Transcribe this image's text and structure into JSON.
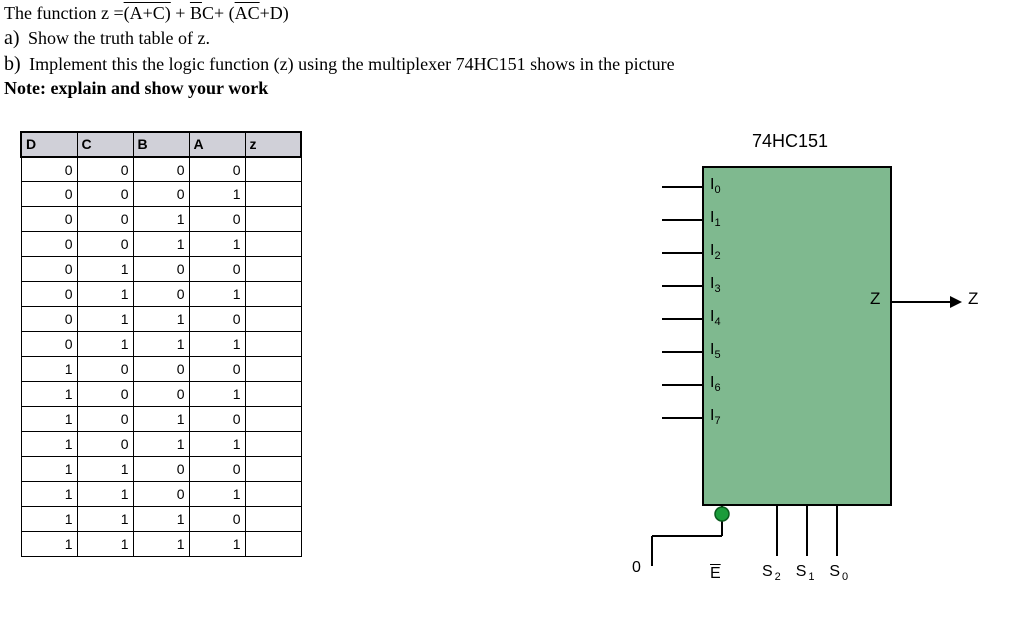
{
  "question": {
    "line1_prefix": "The function z =",
    "line1_term1": "(A+C)",
    "line1_plus1": " + ",
    "line1_Bbar": "B",
    "line1_C": "C+ (",
    "line1_ACbar": "AC",
    "line1_plusD": "+D)",
    "a_label": "a)",
    "a_text": "Show the truth table of z.",
    "b_label": "b)",
    "b_text": "Implement this the logic function (z) using the multiplexer 74HC151 shows in the picture",
    "note_label": "Note: ",
    "note_text": "explain and show your work"
  },
  "table": {
    "headers": [
      "D",
      "C",
      "B",
      "A",
      "z"
    ],
    "rows": [
      [
        "0",
        "0",
        "0",
        "0",
        ""
      ],
      [
        "0",
        "0",
        "0",
        "1",
        ""
      ],
      [
        "0",
        "0",
        "1",
        "0",
        ""
      ],
      [
        "0",
        "0",
        "1",
        "1",
        ""
      ],
      [
        "0",
        "1",
        "0",
        "0",
        ""
      ],
      [
        "0",
        "1",
        "0",
        "1",
        ""
      ],
      [
        "0",
        "1",
        "1",
        "0",
        ""
      ],
      [
        "0",
        "1",
        "1",
        "1",
        ""
      ],
      [
        "1",
        "0",
        "0",
        "0",
        ""
      ],
      [
        "1",
        "0",
        "0",
        "1",
        ""
      ],
      [
        "1",
        "0",
        "1",
        "0",
        ""
      ],
      [
        "1",
        "0",
        "1",
        "1",
        ""
      ],
      [
        "1",
        "1",
        "0",
        "0",
        ""
      ],
      [
        "1",
        "1",
        "0",
        "1",
        ""
      ],
      [
        "1",
        "1",
        "1",
        "0",
        ""
      ],
      [
        "1",
        "1",
        "1",
        "1",
        ""
      ]
    ]
  },
  "chip": {
    "title": "74HC151",
    "inputs": [
      "I",
      "I",
      "I",
      "I",
      "I",
      "I",
      "I",
      "I"
    ],
    "input_subs": [
      "0",
      "1",
      "2",
      "3",
      "4",
      "5",
      "6",
      "7"
    ],
    "enable": "E",
    "selects": "S",
    "select_subs": [
      "2",
      "1",
      "0"
    ],
    "out_z_inside": "Z",
    "out_z_outside": "Z",
    "zero": "0"
  }
}
